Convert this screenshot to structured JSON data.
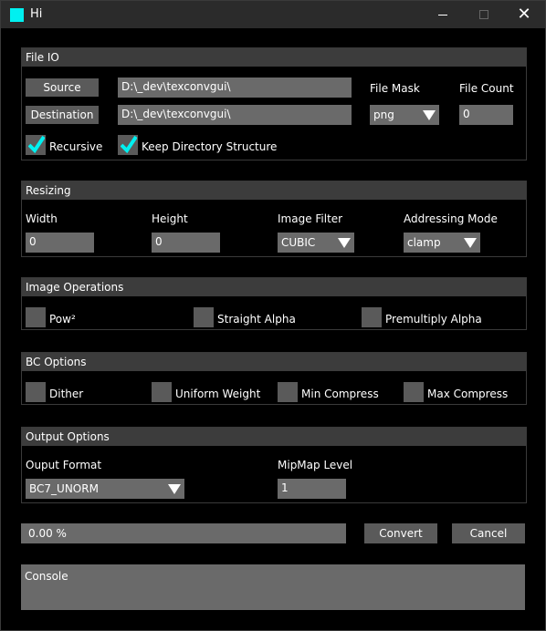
{
  "window": {
    "title": "Hi"
  },
  "file_io": {
    "header": "File IO",
    "source_label": "Source",
    "destination_label": "Destination",
    "source_path": "D:\\_dev\\texconvgui\\",
    "destination_path": "D:\\_dev\\texconvgui\\",
    "file_mask_label": "File Mask",
    "file_mask_value": "png",
    "file_count_label": "File Count",
    "file_count_value": "0",
    "recursive_label": "Recursive",
    "recursive_checked": true,
    "keep_structure_label": "Keep Directory Structure",
    "keep_structure_checked": true
  },
  "resizing": {
    "header": "Resizing",
    "width_label": "Width",
    "width_value": "0",
    "height_label": "Height",
    "height_value": "0",
    "image_filter_label": "Image Filter",
    "image_filter_value": "CUBIC",
    "addressing_mode_label": "Addressing Mode",
    "addressing_mode_value": "clamp"
  },
  "image_operations": {
    "header": "Image Operations",
    "pow2_label": "Pow²",
    "straight_alpha_label": "Straight Alpha",
    "premultiply_alpha_label": "Premultiply Alpha"
  },
  "bc_options": {
    "header": "BC Options",
    "dither_label": "Dither",
    "uniform_weight_label": "Uniform Weight",
    "min_compress_label": "Min Compress",
    "max_compress_label": "Max Compress"
  },
  "output_options": {
    "header": "Output Options",
    "output_format_label": "Ouput Format",
    "output_format_value": "BC7_UNORM",
    "mipmap_level_label": "MipMap Level",
    "mipmap_level_value": "1"
  },
  "bottom": {
    "progress_text": "0.00 %",
    "progress_fraction": 0.0,
    "convert_label": "Convert",
    "cancel_label": "Cancel",
    "console_text": "Console"
  },
  "colors": {
    "accent": "#00f0f0",
    "panel_header": "#3c3c3c",
    "field_bg": "#6a6a6a",
    "button_bg": "#5a5a5a"
  }
}
